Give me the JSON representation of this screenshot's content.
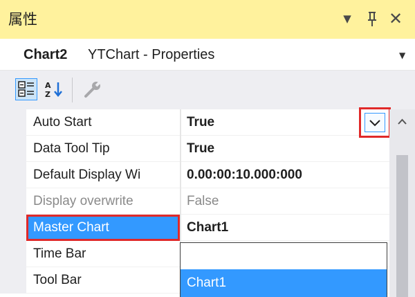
{
  "panel": {
    "title": "属性",
    "dropdown_icon": "▼",
    "pin_icon": "ꟸ",
    "close_icon": "✕"
  },
  "object": {
    "name": "Chart2",
    "type": "YTChart - Properties",
    "dropdown_icon": "▼"
  },
  "toolbar": {
    "categorized_icon": "categorized-icon",
    "alphabetical_icon": "alphabetical-icon",
    "property_pages_icon": "property-pages-icon"
  },
  "properties": [
    {
      "name": "Auto Start",
      "value": "True",
      "bold": true
    },
    {
      "name": "Data Tool Tip",
      "value": "True",
      "bold": true
    },
    {
      "name": "Default Display Wi",
      "value": "0.00:00:10.000:000",
      "bold": true
    },
    {
      "name": "Display overwrite",
      "value": "False",
      "bold": false
    },
    {
      "name": "Master Chart",
      "value": "Chart1",
      "bold": true
    },
    {
      "name": "Time Bar",
      "value": "",
      "bold": false
    },
    {
      "name": "Tool Bar",
      "value": "",
      "bold": false
    }
  ],
  "dropdown": {
    "options": [
      "",
      "Chart1"
    ],
    "selected": "Chart1"
  },
  "colors": {
    "titlebar": "#FFF29D",
    "selection": "#3399FF",
    "highlight_border": "#E02929"
  }
}
